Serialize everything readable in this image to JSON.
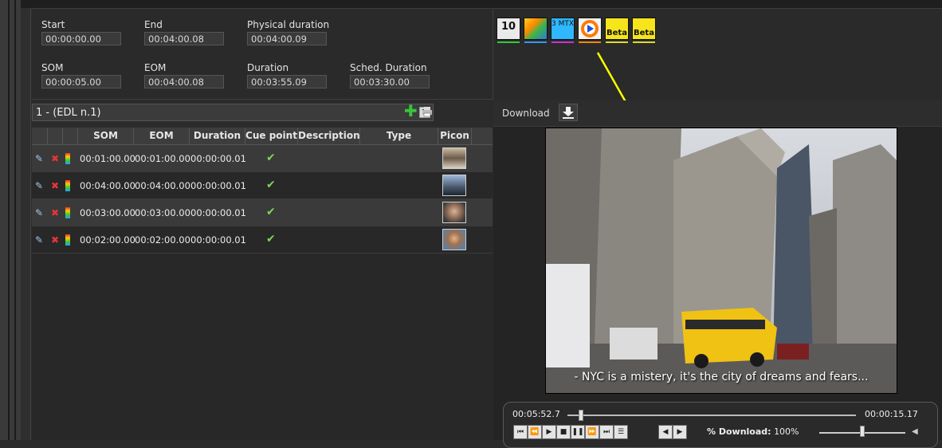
{
  "timing": {
    "start": {
      "label": "Start",
      "value": "00:00:00.00"
    },
    "end": {
      "label": "End",
      "value": "00:04:00.08"
    },
    "physical_duration": {
      "label": "Physical duration",
      "value": "00:04:00.09"
    },
    "som": {
      "label": "SOM",
      "value": "00:00:05.00"
    },
    "eom": {
      "label": "EOM",
      "value": "00:04:00.08"
    },
    "duration": {
      "label": "Duration",
      "value": "00:03:55.09"
    },
    "sched_duration": {
      "label": "Sched. Duration",
      "value": "00:03:30.00"
    }
  },
  "tools": [
    {
      "name": "channel-10-icon",
      "text": "10",
      "color": "#33cc33"
    },
    {
      "name": "color-palette-icon",
      "text": "",
      "color": "#3399ff"
    },
    {
      "name": "mtx-icon",
      "text": "3 MTX",
      "color": "#cc33cc"
    },
    {
      "name": "play-disc-icon",
      "text": "",
      "color": "#ff8800"
    },
    {
      "name": "beta-tape-icon",
      "text": "Beta",
      "color": "#dddd22"
    },
    {
      "name": "beta-tape-icon-2",
      "text": "Beta",
      "color": "#dddd22"
    }
  ],
  "edl": {
    "selected": "1 - (EDL n.1)"
  },
  "table": {
    "headers": [
      "SOM",
      "EOM",
      "Duration",
      "Cue point",
      "Description",
      "Type",
      "Picon"
    ],
    "rows": [
      {
        "som": "00:01:00.00",
        "eom": "00:01:00.00",
        "duration": "00:00:00.01",
        "cue": "✔"
      },
      {
        "som": "00:04:00.00",
        "eom": "00:04:00.00",
        "duration": "00:00:00.01",
        "cue": "✔"
      },
      {
        "som": "00:03:00.00",
        "eom": "00:03:00.00",
        "duration": "00:00:00.01",
        "cue": "✔"
      },
      {
        "som": "00:02:00.00",
        "eom": "00:02:00.00",
        "duration": "00:00:00.01",
        "cue": "✔"
      }
    ]
  },
  "download": {
    "label": "Download"
  },
  "video": {
    "subtitle": "- NYC is a mistery, it's the city of dreams and fears..."
  },
  "player": {
    "current_time": "00:05:52.7",
    "remaining_time": "00:00:15.17",
    "download_label": "% Download:",
    "download_value": "100%",
    "position": 0.04,
    "volume": 0.5
  },
  "colors": {
    "accent_add": "#39c43c",
    "delete": "#e83535",
    "annotation_arrow": "#ffff00"
  }
}
